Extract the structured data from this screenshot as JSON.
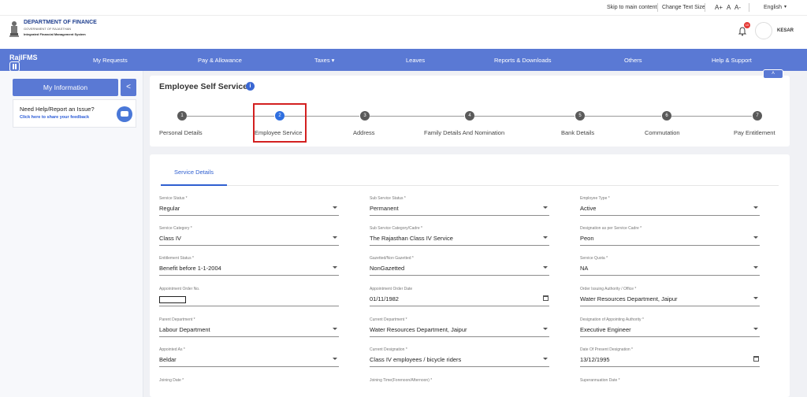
{
  "util_bar": {
    "skip": "Skip to main content",
    "text_size_label": "Change Text Size",
    "size_options": [
      "A+",
      "A",
      "A-"
    ],
    "language": "English"
  },
  "header": {
    "org_title": "DEPARTMENT OF FINANCE",
    "org_sub": "GOVERNMENT OF RAJASTHAN",
    "org_system": "Integrated Financial Management System",
    "notification_count": "10",
    "user_name": "KESAR"
  },
  "nav": {
    "brand": "RajIFMS",
    "items": [
      "My Requests",
      "Pay & Allowance",
      "Taxes ▾",
      "Leaves",
      "Reports & Downloads",
      "Others",
      "Help & Support"
    ],
    "collapse": "˄"
  },
  "sidebar": {
    "my_information": "My Information",
    "toggle": "<",
    "help_title": "Need Help/Report an Issue?",
    "help_link": "Click here to share your feedback"
  },
  "main": {
    "title": "Employee Self Service",
    "info": "i",
    "steps": [
      {
        "num": "1",
        "label": "Personal Details"
      },
      {
        "num": "2",
        "label": "Employee Service"
      },
      {
        "num": "3",
        "label": "Address"
      },
      {
        "num": "4",
        "label": "Family Details And Nomination"
      },
      {
        "num": "5",
        "label": "Bank Details"
      },
      {
        "num": "6",
        "label": "Commutation"
      },
      {
        "num": "7",
        "label": "Pay Entitlement"
      }
    ],
    "active_step": 2,
    "tab": "Service Details",
    "fields": [
      {
        "label": "Service Status *",
        "value": "Regular"
      },
      {
        "label": "Sub Service Status *",
        "value": "Permanent"
      },
      {
        "label": "Employee Type *",
        "value": "Active"
      },
      {
        "label": "Service Category *",
        "value": "Class IV"
      },
      {
        "label": "Sub Service Category/Cadre *",
        "value": "The Rajasthan Class IV Service"
      },
      {
        "label": "Designation as per Service Cadre *",
        "value": "Peon"
      },
      {
        "label": "Entitlement Status *",
        "value": "Benefit before 1-1-2004"
      },
      {
        "label": "Gazetted/Non Gazetted *",
        "value": "NonGazetted"
      },
      {
        "label": "Service Quota *",
        "value": "NA"
      },
      {
        "label": "Appointment Order No.",
        "value": ""
      },
      {
        "label": "Appointment Order Date",
        "value": "01/11/1982"
      },
      {
        "label": "Order Issuing Authority / Office *",
        "value": "Water Resources Department, Jaipur"
      },
      {
        "label": "Parent Department *",
        "value": "Labour Department"
      },
      {
        "label": "Current Department *",
        "value": "Water Resources Department, Jaipur"
      },
      {
        "label": "Designation of Appointing Authority *",
        "value": "Executive Engineer"
      },
      {
        "label": "Appointed As *",
        "value": "Beldar"
      },
      {
        "label": "Current Designation *",
        "value": "Class IV employees / bicycle riders"
      },
      {
        "label": "Date Of Present Designation *",
        "value": "13/12/1995"
      },
      {
        "label": "Joining Date *",
        "value": ""
      },
      {
        "label": "Joining Time(Forenoon/Afternoon) *",
        "value": ""
      },
      {
        "label": "Superannuation Date *",
        "value": ""
      }
    ]
  },
  "colors": {
    "primary": "#5a79d4",
    "active_step": "#2f6fe0",
    "highlight": "#d32020"
  }
}
